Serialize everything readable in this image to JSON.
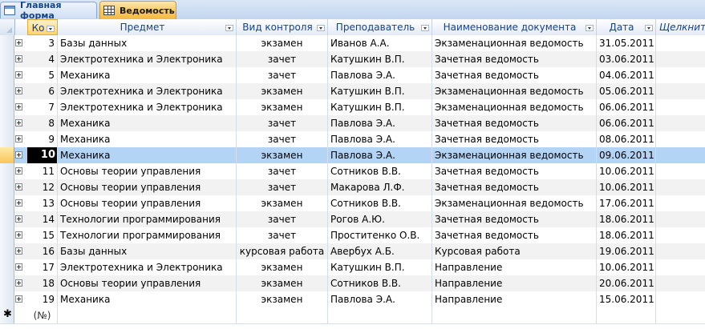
{
  "tabs": [
    {
      "label": "Главная форма",
      "icon": "form-icon"
    },
    {
      "label": "Ведомость",
      "icon": "table-icon",
      "active": true
    }
  ],
  "columns": [
    {
      "key": "ko",
      "label": "Ко"
    },
    {
      "key": "subject",
      "label": "Предмет"
    },
    {
      "key": "control",
      "label": "Вид контроля"
    },
    {
      "key": "teacher",
      "label": "Преподаватель"
    },
    {
      "key": "document",
      "label": "Наименование документа"
    },
    {
      "key": "date",
      "label": "Дата"
    },
    {
      "key": "add",
      "label": "Щелкните для добавления"
    }
  ],
  "rows": [
    {
      "ko": "3",
      "subject": "Базы данных",
      "control": "экзамен",
      "teacher": "Иванов А.А.",
      "document": "Экзаменационная ведомость",
      "date": "31.05.2011"
    },
    {
      "ko": "4",
      "subject": "Электротехника и Электроника",
      "control": "зачет",
      "teacher": "Катушкин В.П.",
      "document": "Зачетная ведомость",
      "date": "03.06.2011"
    },
    {
      "ko": "5",
      "subject": "Механика",
      "control": "зачет",
      "teacher": "Павлова Э.А.",
      "document": "Зачетная ведомость",
      "date": "04.06.2011"
    },
    {
      "ko": "6",
      "subject": "Электротехника и Электроника",
      "control": "экзамен",
      "teacher": "Катушкин В.П.",
      "document": "Экзаменационная ведомость",
      "date": "05.06.2011"
    },
    {
      "ko": "7",
      "subject": "Электротехника и Электроника",
      "control": "экзамен",
      "teacher": "Катушкин В.П.",
      "document": "Экзаменационная ведомость",
      "date": "06.06.2011"
    },
    {
      "ko": "8",
      "subject": "Механика",
      "control": "зачет",
      "teacher": "Павлова Э.А.",
      "document": "Зачетная ведомость",
      "date": "06.06.2011"
    },
    {
      "ko": "9",
      "subject": "Механика",
      "control": "зачет",
      "teacher": "Павлова Э.А.",
      "document": "Зачетная ведомость",
      "date": "08.06.2011"
    },
    {
      "ko": "10",
      "subject": "Механика",
      "control": "экзамен",
      "teacher": "Павлова Э.А.",
      "document": "Экзаменационная ведомость",
      "date": "09.06.2011",
      "selected": true
    },
    {
      "ko": "11",
      "subject": "Основы теории управления",
      "control": "зачет",
      "teacher": "Сотников В.В.",
      "document": "Зачетная ведомость",
      "date": "10.06.2011"
    },
    {
      "ko": "12",
      "subject": "Основы теории управления",
      "control": "зачет",
      "teacher": "Макарова Л.Ф.",
      "document": "Зачетная ведомость",
      "date": "10.06.2011"
    },
    {
      "ko": "13",
      "subject": "Основы теории управления",
      "control": "экзамен",
      "teacher": "Сотников В.В.",
      "document": "Экзаменационная ведомость",
      "date": "17.06.2011"
    },
    {
      "ko": "14",
      "subject": "Технологии программирования",
      "control": "зачет",
      "teacher": "Рогов А.Ю.",
      "document": "Зачетная ведомость",
      "date": "18.06.2011"
    },
    {
      "ko": "15",
      "subject": "Технологии программирования",
      "control": "зачет",
      "teacher": "Проститенко О.В.",
      "document": "Зачетная ведомость",
      "date": "18.06.2011"
    },
    {
      "ko": "16",
      "subject": "Базы данных",
      "control": "курсовая работа",
      "teacher": "Авербух А.Б.",
      "document": "Курсовая работа",
      "date": "19.06.2011"
    },
    {
      "ko": "17",
      "subject": "Электротехника и Электроника",
      "control": "экзамен",
      "teacher": "Катушкин В.П.",
      "document": "Направление",
      "date": "10.06.2011"
    },
    {
      "ko": "18",
      "subject": "Основы теории управления",
      "control": "экзамен",
      "teacher": "Сотников В.В.",
      "document": "Направление",
      "date": "20.06.2011"
    },
    {
      "ko": "19",
      "subject": "Механика",
      "control": "экзамен",
      "teacher": "Павлова Э.А.",
      "document": "Направление",
      "date": "15.06.2011"
    }
  ],
  "new_row": {
    "marker": "✱",
    "placeholder": "(№)"
  },
  "colors": {
    "accent": "#f8c864",
    "header_text": "#15428b",
    "selection": "#b4d4f6"
  }
}
